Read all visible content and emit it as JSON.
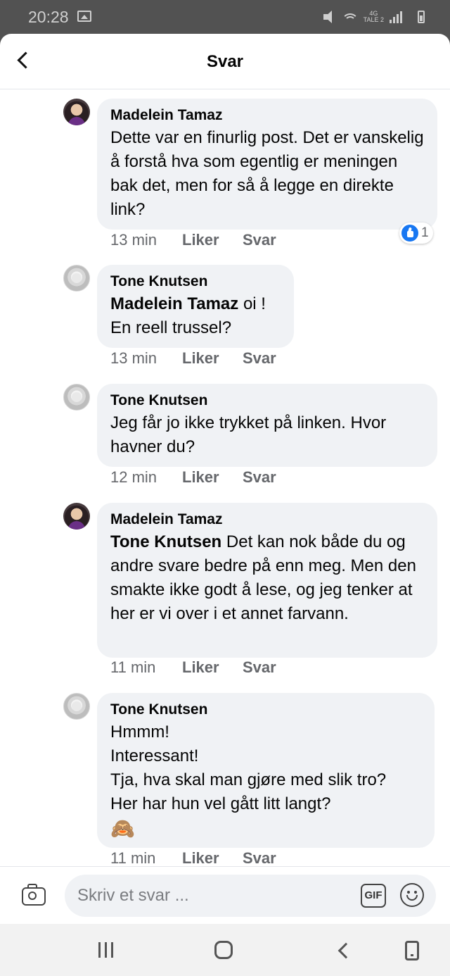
{
  "status_bar": {
    "time": "20:28",
    "network_label": "4G",
    "carrier_label": "TALE 2",
    "icons": [
      "gallery-icon",
      "mute-icon",
      "wifi-icon",
      "signal-icon",
      "battery-icon"
    ]
  },
  "header": {
    "title": "Svar",
    "back_icon": "chevron-left-icon"
  },
  "comments": [
    {
      "author": "Madelein Tamaz",
      "mention": "",
      "text": "Dette var en finurlig post. Det er vanskelig å forstå hva som egentlig er meningen bak det, men for så å legge en direkte link?",
      "time": "13 min",
      "like_label": "Liker",
      "reply_label": "Svar",
      "reaction_count": "1"
    },
    {
      "author": "Tone Knutsen",
      "mention": "Madelein Tamaz",
      "text": " oi !\nEn reell trussel?",
      "time": "13 min",
      "like_label": "Liker",
      "reply_label": "Svar"
    },
    {
      "author": "Tone Knutsen",
      "mention": "",
      "text": "Jeg får jo ikke trykket på linken. Hvor havner du?",
      "time": "12 min",
      "like_label": "Liker",
      "reply_label": "Svar"
    },
    {
      "author": "Madelein Tamaz",
      "mention": "Tone Knutsen",
      "text": " Det kan nok både du og andre svare bedre på enn meg. Men den smakte ikke godt å lese, og jeg tenker at her er vi over i et annet farvann.",
      "time": "11 min",
      "like_label": "Liker",
      "reply_label": "Svar"
    },
    {
      "author": "Tone Knutsen",
      "mention": "",
      "text": "Hmmm!\nInteressant!\nTja, hva skal man gjøre med slik tro?\nHer har hun vel gått litt langt?",
      "emoji": "🙈",
      "time": "11 min",
      "like_label": "Liker",
      "reply_label": "Svar"
    }
  ],
  "composer": {
    "placeholder": "Skriv et svar ...",
    "gif_label": "GIF"
  },
  "colors": {
    "bubble": "#f0f2f5",
    "accent": "#1877f2",
    "muted_text": "#65676b"
  }
}
